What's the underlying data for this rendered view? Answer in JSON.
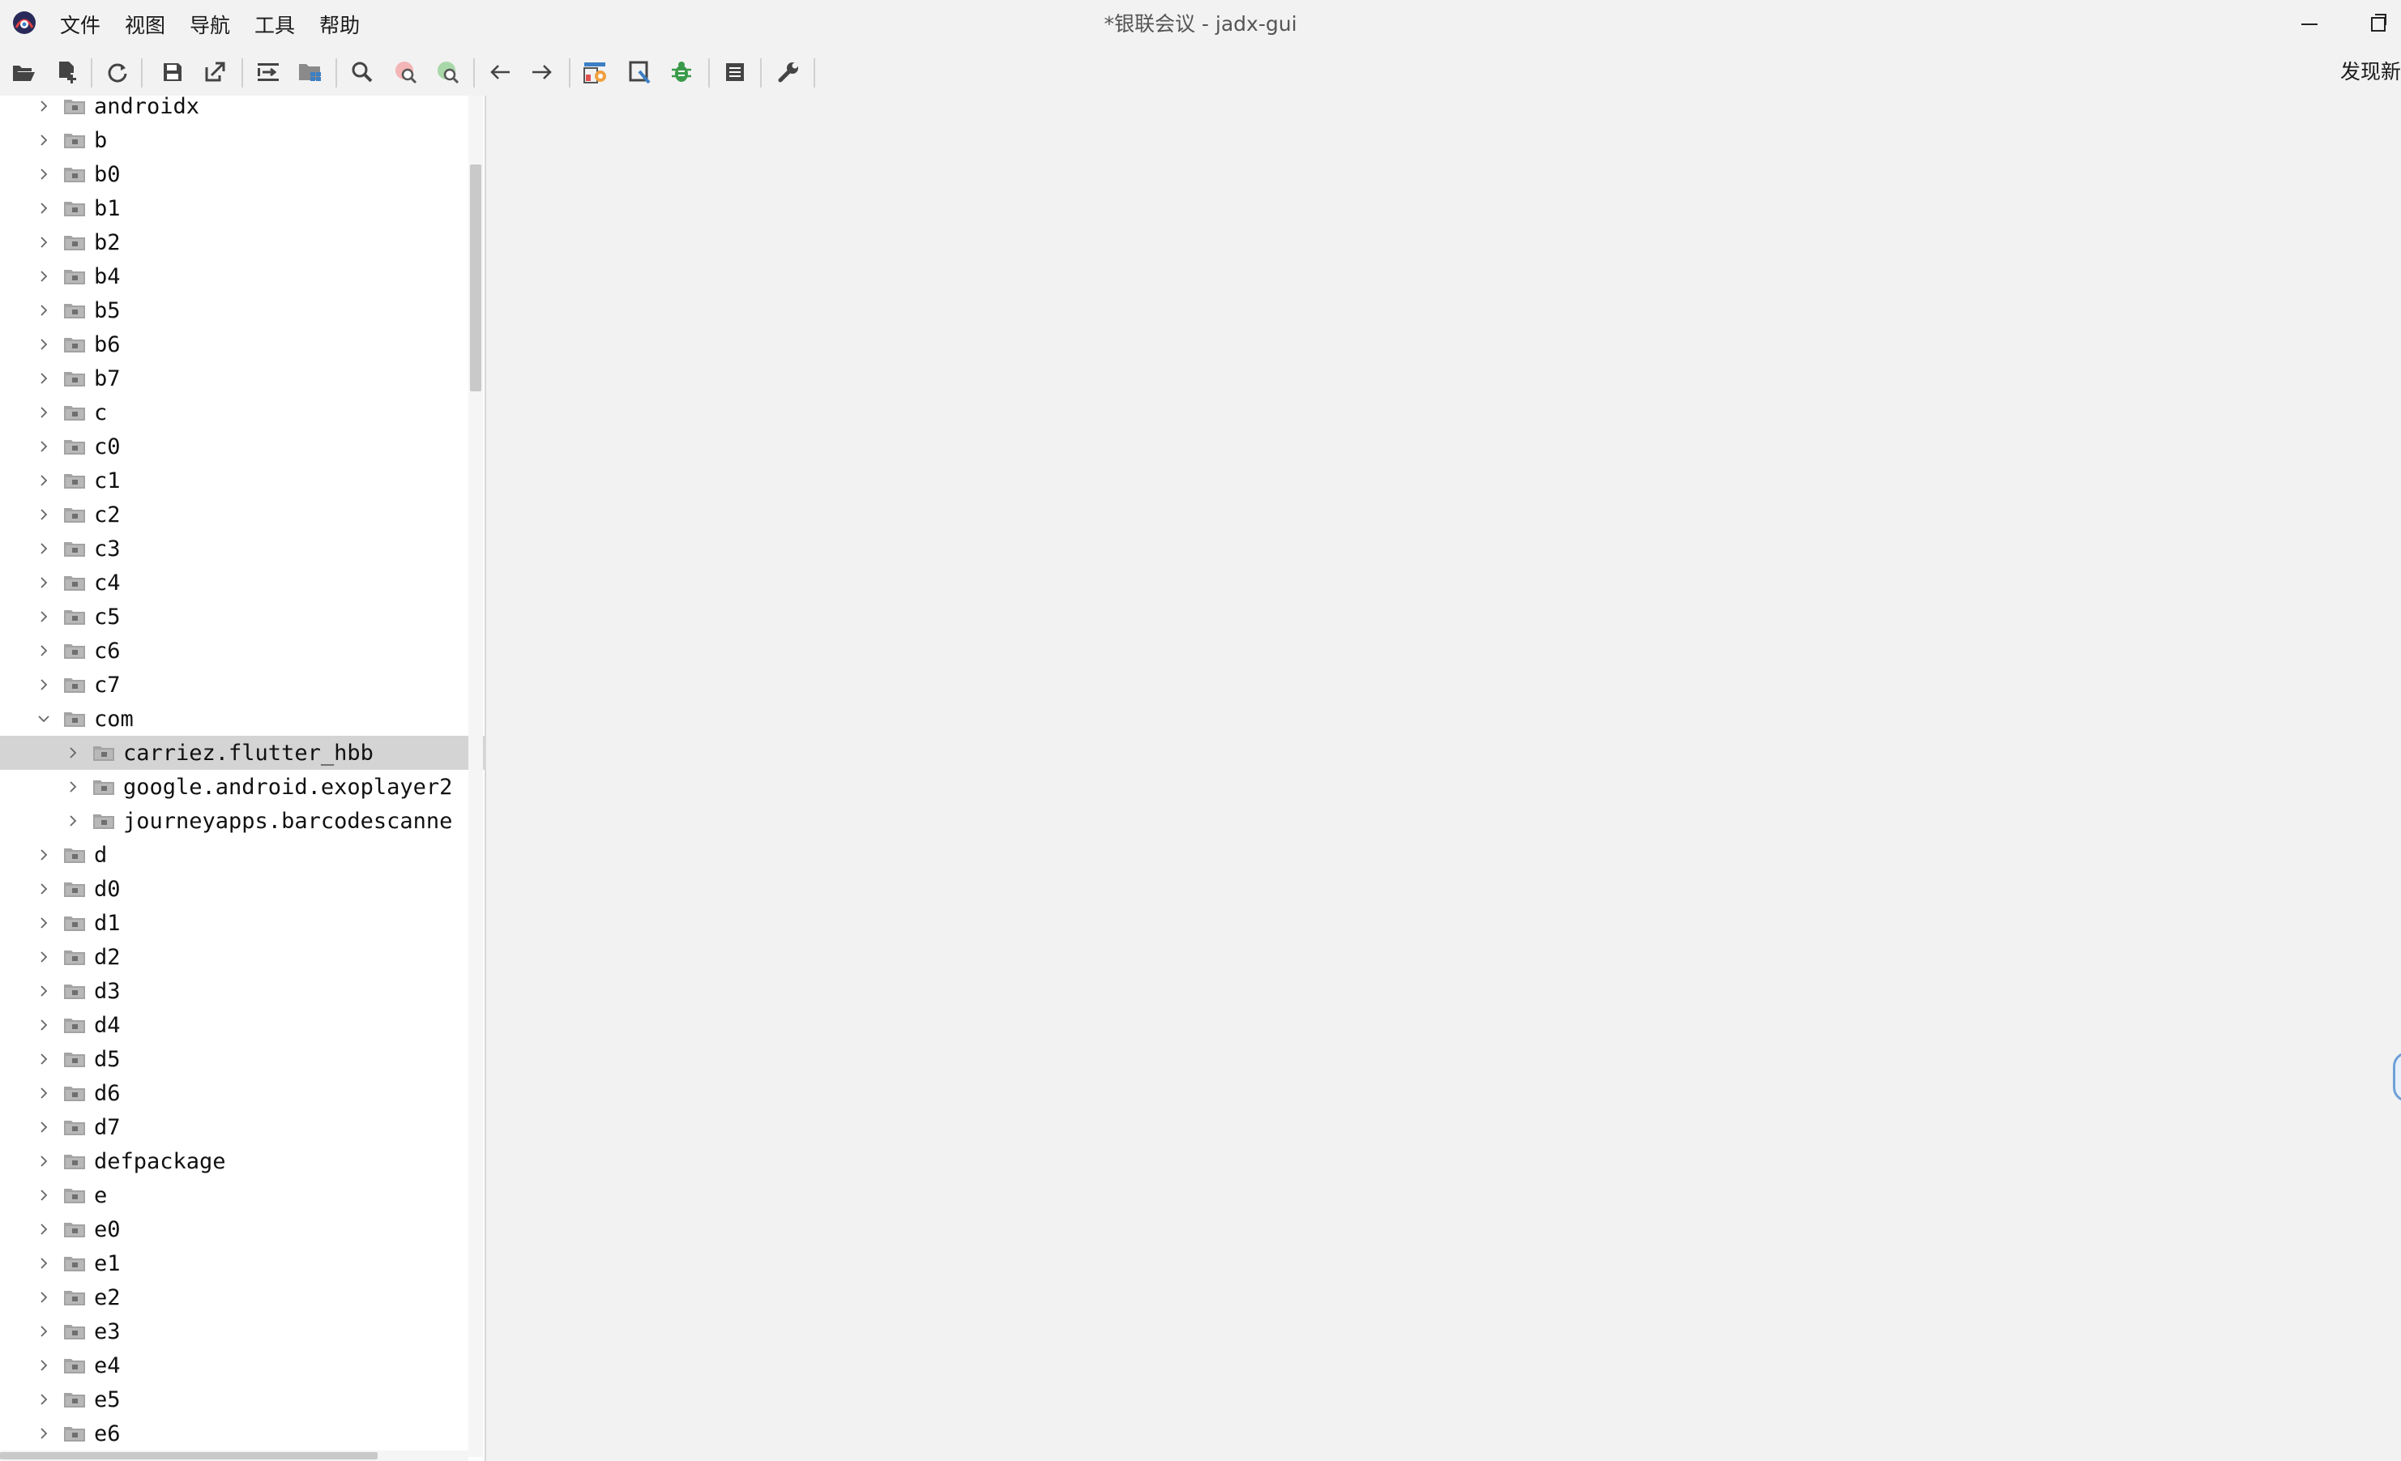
{
  "window": {
    "title": "*银联会议 - jadx-gui"
  },
  "menu": {
    "items": [
      "文件",
      "视图",
      "导航",
      "工具",
      "帮助"
    ]
  },
  "toolbar": {
    "update_note": "发现新版本"
  },
  "tree": {
    "items": [
      {
        "label": "androidx",
        "depth": 0,
        "expanded": false,
        "selected": false
      },
      {
        "label": "b",
        "depth": 0,
        "expanded": false,
        "selected": false
      },
      {
        "label": "b0",
        "depth": 0,
        "expanded": false,
        "selected": false
      },
      {
        "label": "b1",
        "depth": 0,
        "expanded": false,
        "selected": false
      },
      {
        "label": "b2",
        "depth": 0,
        "expanded": false,
        "selected": false
      },
      {
        "label": "b4",
        "depth": 0,
        "expanded": false,
        "selected": false
      },
      {
        "label": "b5",
        "depth": 0,
        "expanded": false,
        "selected": false
      },
      {
        "label": "b6",
        "depth": 0,
        "expanded": false,
        "selected": false
      },
      {
        "label": "b7",
        "depth": 0,
        "expanded": false,
        "selected": false
      },
      {
        "label": "c",
        "depth": 0,
        "expanded": false,
        "selected": false
      },
      {
        "label": "c0",
        "depth": 0,
        "expanded": false,
        "selected": false
      },
      {
        "label": "c1",
        "depth": 0,
        "expanded": false,
        "selected": false
      },
      {
        "label": "c2",
        "depth": 0,
        "expanded": false,
        "selected": false
      },
      {
        "label": "c3",
        "depth": 0,
        "expanded": false,
        "selected": false
      },
      {
        "label": "c4",
        "depth": 0,
        "expanded": false,
        "selected": false
      },
      {
        "label": "c5",
        "depth": 0,
        "expanded": false,
        "selected": false
      },
      {
        "label": "c6",
        "depth": 0,
        "expanded": false,
        "selected": false
      },
      {
        "label": "c7",
        "depth": 0,
        "expanded": false,
        "selected": false
      },
      {
        "label": "com",
        "depth": 0,
        "expanded": true,
        "selected": false
      },
      {
        "label": "carriez.flutter_hbb",
        "depth": 1,
        "expanded": false,
        "selected": true
      },
      {
        "label": "google.android.exoplayer2",
        "depth": 1,
        "expanded": false,
        "selected": false
      },
      {
        "label": "journeyapps.barcodescanne",
        "depth": 1,
        "expanded": false,
        "selected": false
      },
      {
        "label": "d",
        "depth": 0,
        "expanded": false,
        "selected": false
      },
      {
        "label": "d0",
        "depth": 0,
        "expanded": false,
        "selected": false
      },
      {
        "label": "d1",
        "depth": 0,
        "expanded": false,
        "selected": false
      },
      {
        "label": "d2",
        "depth": 0,
        "expanded": false,
        "selected": false
      },
      {
        "label": "d3",
        "depth": 0,
        "expanded": false,
        "selected": false
      },
      {
        "label": "d4",
        "depth": 0,
        "expanded": false,
        "selected": false
      },
      {
        "label": "d5",
        "depth": 0,
        "expanded": false,
        "selected": false
      },
      {
        "label": "d6",
        "depth": 0,
        "expanded": false,
        "selected": false
      },
      {
        "label": "d7",
        "depth": 0,
        "expanded": false,
        "selected": false
      },
      {
        "label": "defpackage",
        "depth": 0,
        "expanded": false,
        "selected": false
      },
      {
        "label": "e",
        "depth": 0,
        "expanded": false,
        "selected": false
      },
      {
        "label": "e0",
        "depth": 0,
        "expanded": false,
        "selected": false
      },
      {
        "label": "e1",
        "depth": 0,
        "expanded": false,
        "selected": false
      },
      {
        "label": "e2",
        "depth": 0,
        "expanded": false,
        "selected": false
      },
      {
        "label": "e3",
        "depth": 0,
        "expanded": false,
        "selected": false
      },
      {
        "label": "e4",
        "depth": 0,
        "expanded": false,
        "selected": false
      },
      {
        "label": "e5",
        "depth": 0,
        "expanded": false,
        "selected": false
      },
      {
        "label": "e6",
        "depth": 0,
        "expanded": false,
        "selected": false
      }
    ]
  },
  "colors": {
    "selection": "#d4d4d4",
    "accent_green": "#3a9a4a",
    "accent_blue": "#3b7fc4",
    "accent_red": "#e05050"
  }
}
